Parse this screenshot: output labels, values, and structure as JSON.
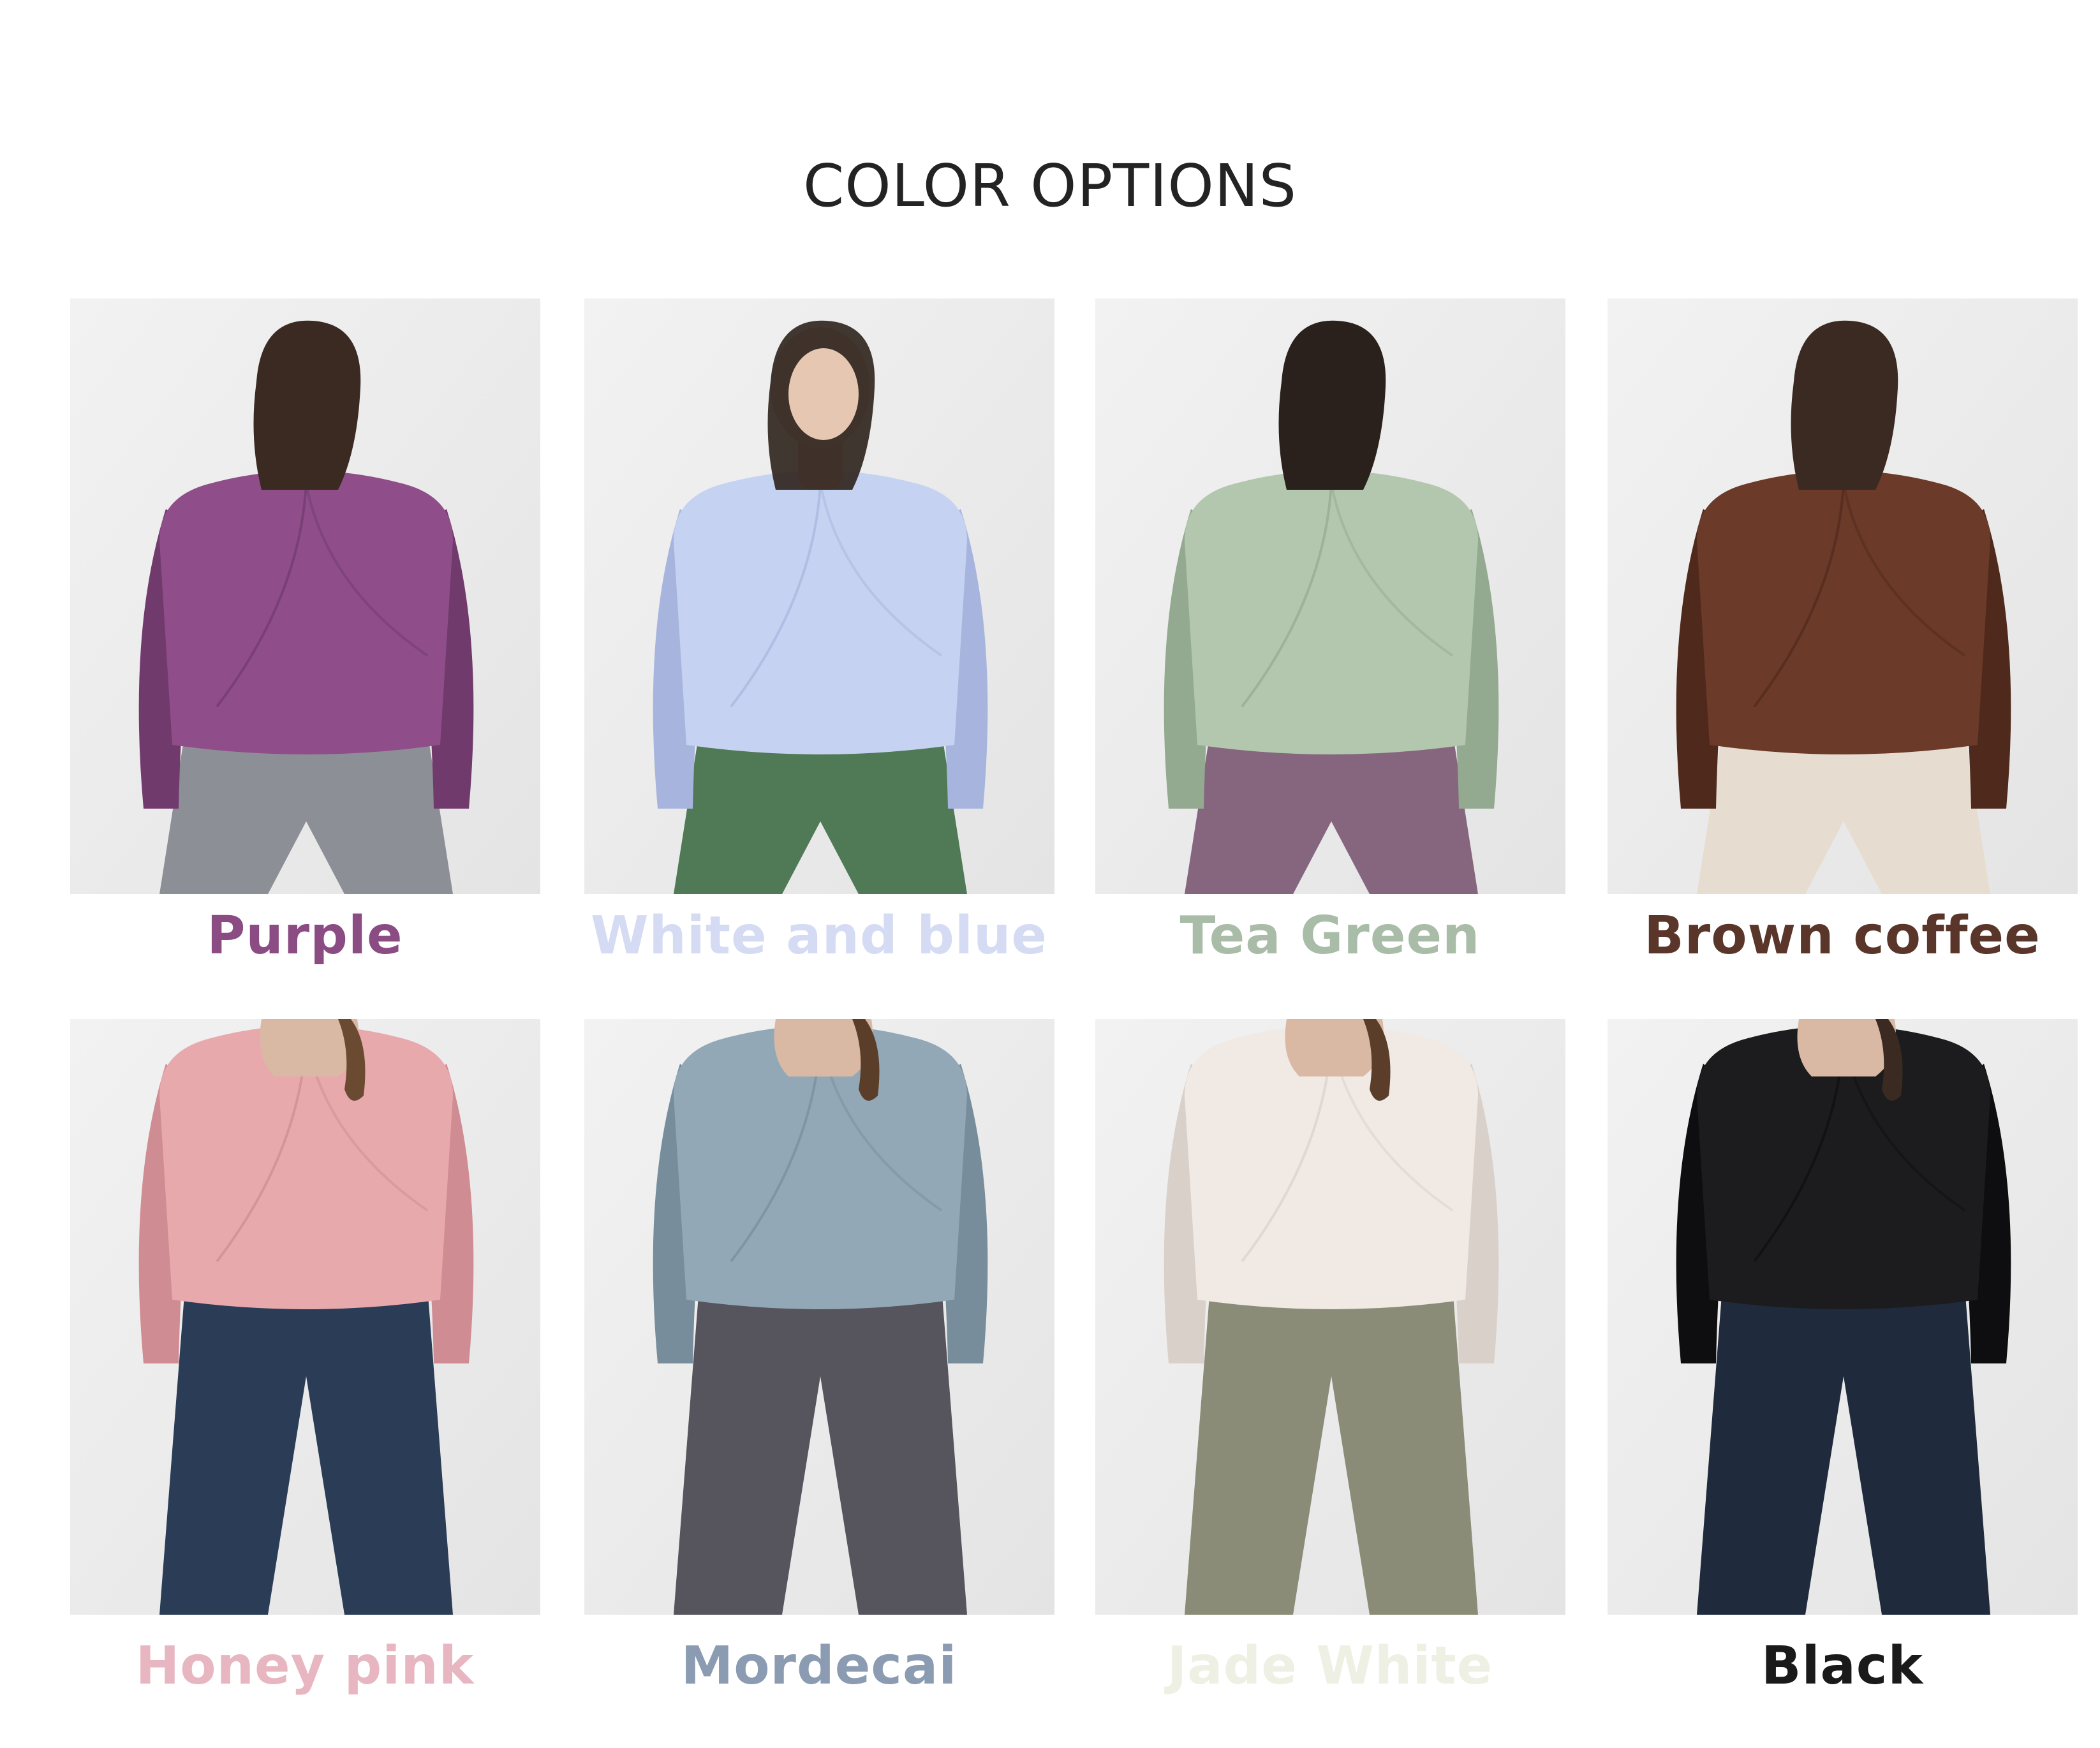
{
  "page": {
    "title": "COLOR OPTIONS"
  },
  "options": [
    {
      "name": "Purple",
      "label_color": "#8b4b83",
      "shirt": "#8f4e8a",
      "shirt_dark": "#713a6d",
      "pants": "#8d8f96",
      "view": "back",
      "hair": "#3a2a22"
    },
    {
      "name": "White and blue",
      "label_color": "#d4dbf3",
      "shirt": "#c6d2f1",
      "shirt_dark": "#a7b5de",
      "pants": "#4f7a55",
      "view": "front",
      "hair": "#2e221c"
    },
    {
      "name": "Tea Green",
      "label_color": "#a9bca7",
      "shirt": "#b2c7ae",
      "shirt_dark": "#93a990",
      "pants": "#86657f",
      "view": "back",
      "hair": "#2a201c"
    },
    {
      "name": "Brown coffee",
      "label_color": "#5a352a",
      "shirt": "#6b3a28",
      "shirt_dark": "#4f2a1c",
      "pants": "#e6ddd0",
      "view": "back",
      "hair": "#3a2a22"
    },
    {
      "name": "Honey pink",
      "label_color": "#e7b6c0",
      "shirt": "#e8a9ad",
      "shirt_dark": "#cf8c92",
      "pants": "#2b3c56",
      "view": "back",
      "hair": "#6b4a32"
    },
    {
      "name": "Mordecai",
      "label_color": "#8a9bb2",
      "shirt": "#93a8b6",
      "shirt_dark": "#778d9c",
      "pants": "#56545c",
      "view": "back",
      "hair": "#5a3e2a"
    },
    {
      "name": "Jade White",
      "label_color": "#eef0e3",
      "shirt": "#f0e9e4",
      "shirt_dark": "#d9d0ca",
      "pants": "#8a8c77",
      "view": "back",
      "hair": "#5a3e2a"
    },
    {
      "name": "Black",
      "label_color": "#1a1a1a",
      "shirt": "#1c1c1e",
      "shirt_dark": "#0e0e10",
      "pants": "#1f2a3c",
      "view": "back",
      "hair": "#3a2a22"
    }
  ]
}
